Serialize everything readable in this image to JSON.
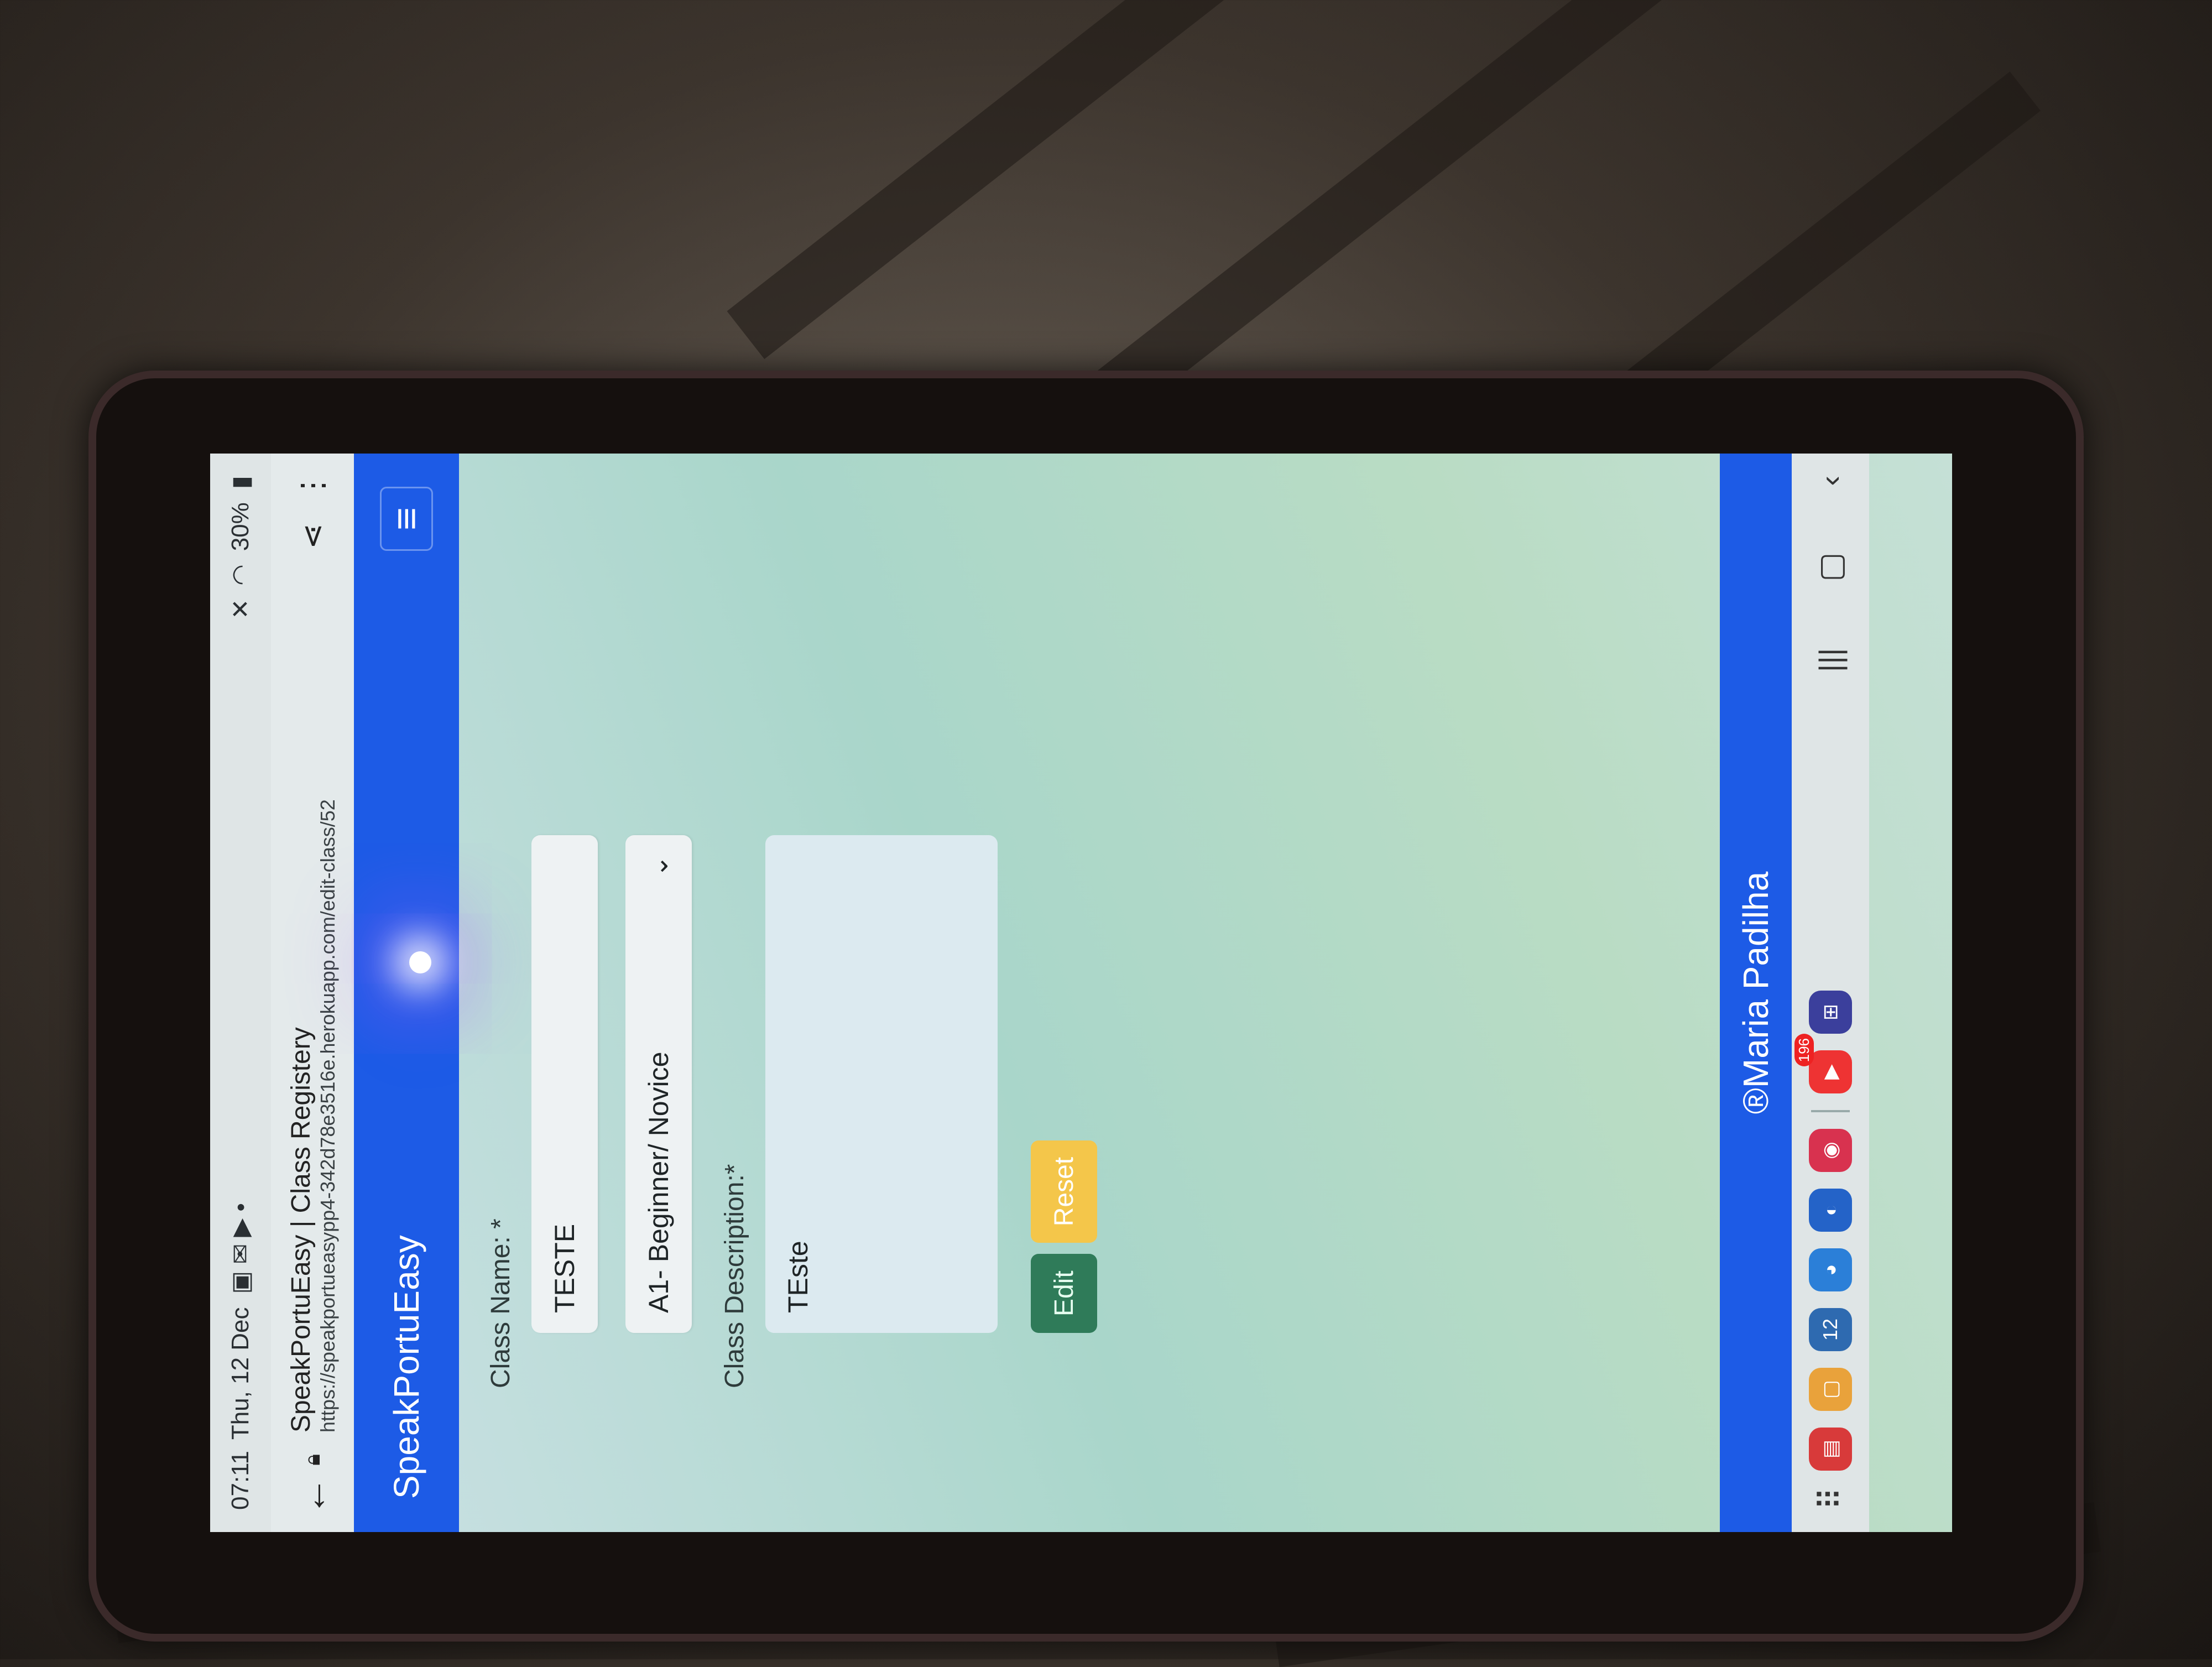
{
  "status_bar": {
    "time": "07:11",
    "date": "Thu, 12 Dec",
    "battery": "30%"
  },
  "browser": {
    "page_title": "SpeakPortuEasy | Class Registery",
    "url": "https://speakportueasypp4-342d78e3516e.herokuapp.com/edit-class/52"
  },
  "navbar": {
    "brand": "SpeakPortuEasy"
  },
  "form": {
    "class_name_label": "Class Name: *",
    "class_name_value": "TESTE",
    "level_value": "A1- Beginner/ Novice",
    "description_label": "Class Description:*",
    "description_value": "TEste",
    "edit_button": "Edit",
    "reset_button": "Reset"
  },
  "footer": {
    "text": "®Maria Padilha"
  },
  "dock": {
    "badge": "196",
    "calendar_day": "12",
    "apps": [
      "pdf-app-icon",
      "notes-app-icon",
      "calendar-app-icon",
      "edge-app-icon",
      "browser-app-icon",
      "camera-app-icon",
      "youtube-app-icon",
      "grid-app-icon"
    ]
  }
}
